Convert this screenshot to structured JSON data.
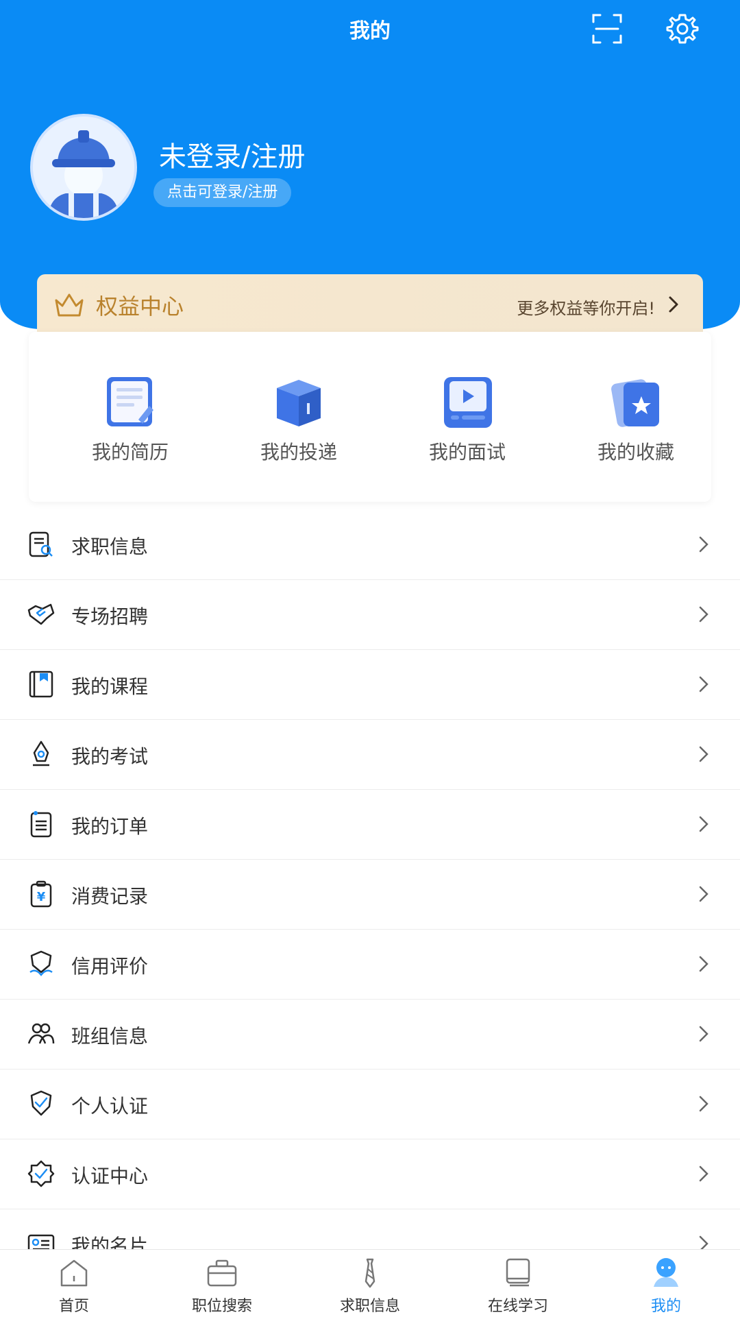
{
  "header": {
    "title": "我的",
    "login_title": "未登录/注册",
    "login_hint": "点击可登录/注册"
  },
  "rights": {
    "title": "权益中心",
    "more": "更多权益等你开启!"
  },
  "quick": [
    {
      "label": "我的简历",
      "icon": "resume-icon"
    },
    {
      "label": "我的投递",
      "icon": "delivery-box-icon"
    },
    {
      "label": "我的面试",
      "icon": "interview-video-icon"
    },
    {
      "label": "我的收藏",
      "icon": "favorite-star-icon"
    }
  ],
  "menu": [
    {
      "label": "求职信息",
      "icon": "job-info-icon"
    },
    {
      "label": "专场招聘",
      "icon": "handshake-icon"
    },
    {
      "label": "我的课程",
      "icon": "course-book-icon"
    },
    {
      "label": "我的考试",
      "icon": "exam-pen-icon"
    },
    {
      "label": "我的订单",
      "icon": "order-list-icon"
    },
    {
      "label": "消费记录",
      "icon": "consumption-yen-icon"
    },
    {
      "label": "信用评价",
      "icon": "credit-shield-icon"
    },
    {
      "label": "班组信息",
      "icon": "team-people-icon"
    },
    {
      "label": "个人认证",
      "icon": "personal-verify-icon"
    },
    {
      "label": "认证中心",
      "icon": "verify-badge-icon"
    },
    {
      "label": "我的名片",
      "icon": "business-card-icon"
    }
  ],
  "tabs": [
    {
      "label": "首页",
      "icon": "home-icon"
    },
    {
      "label": "职位搜索",
      "icon": "briefcase-icon"
    },
    {
      "label": "求职信息",
      "icon": "tie-icon"
    },
    {
      "label": "在线学习",
      "icon": "book-icon"
    },
    {
      "label": "我的",
      "icon": "profile-face-icon",
      "active": true
    }
  ],
  "colors": {
    "primary": "#0a8bf5",
    "rights_bg": "#f7e8cf",
    "rights_text": "#b9822d",
    "active_tab": "#1b8df4"
  }
}
